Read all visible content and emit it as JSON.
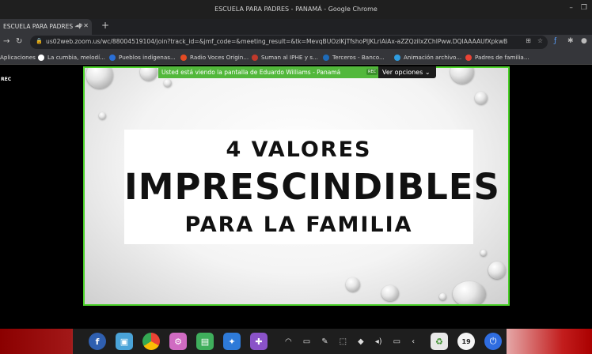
{
  "window": {
    "title": "ESCUELA PARA PADRES - PANAMÁ - Google Chrome"
  },
  "tab": {
    "title": "ESCUELA PARA PADRES - P"
  },
  "omnibox": {
    "url": "us02web.zoom.us/wc/88004519104/join?track_id=&jmf_code=&meeting_result=&tk=MevqBUOzIKjTfshoPIJKLriAiAx-aZZQziIxZChIPww.DQIAAAAUfXpkwB"
  },
  "bookmarks": [
    {
      "label": "Aplicaciones",
      "icon": "apps-grid-icon",
      "color": "#4285f4"
    },
    {
      "label": "La cumbia, melodí...",
      "icon": "wikipedia-icon",
      "color": "#ffffff"
    },
    {
      "label": "Pueblos indígenas...",
      "icon": "site-icon",
      "color": "#2a6fd6"
    },
    {
      "label": "Radio Voces Origin...",
      "icon": "radio-icon",
      "color": "#e44b23"
    },
    {
      "label": "Suman al IPHE y s...",
      "icon": "news-icon",
      "color": "#c0392b"
    },
    {
      "label": "Terceros - Banco...",
      "icon": "bank-icon",
      "color": "#1e6bb8"
    },
    {
      "label": "Animación archivo...",
      "icon": "edge-icon",
      "color": "#2f9de0"
    },
    {
      "label": "Padres de familia...",
      "icon": "google-icon",
      "color": "#ea4335"
    }
  ],
  "zoom": {
    "rec_label": "REC",
    "share_banner": "Usted está viendo la pantalla de Eduardo Williams - Panamá",
    "banner_rec": "REC",
    "view_options": "Ver opciones"
  },
  "slide": {
    "line1": "4 VALORES",
    "line2": "IMPRESCINDIBLES",
    "line3": "PARA LA FAMILIA"
  },
  "taskbar": {
    "clock": "19"
  },
  "colors": {
    "accent_green": "#4ad028",
    "banner_green": "#52b83b"
  }
}
